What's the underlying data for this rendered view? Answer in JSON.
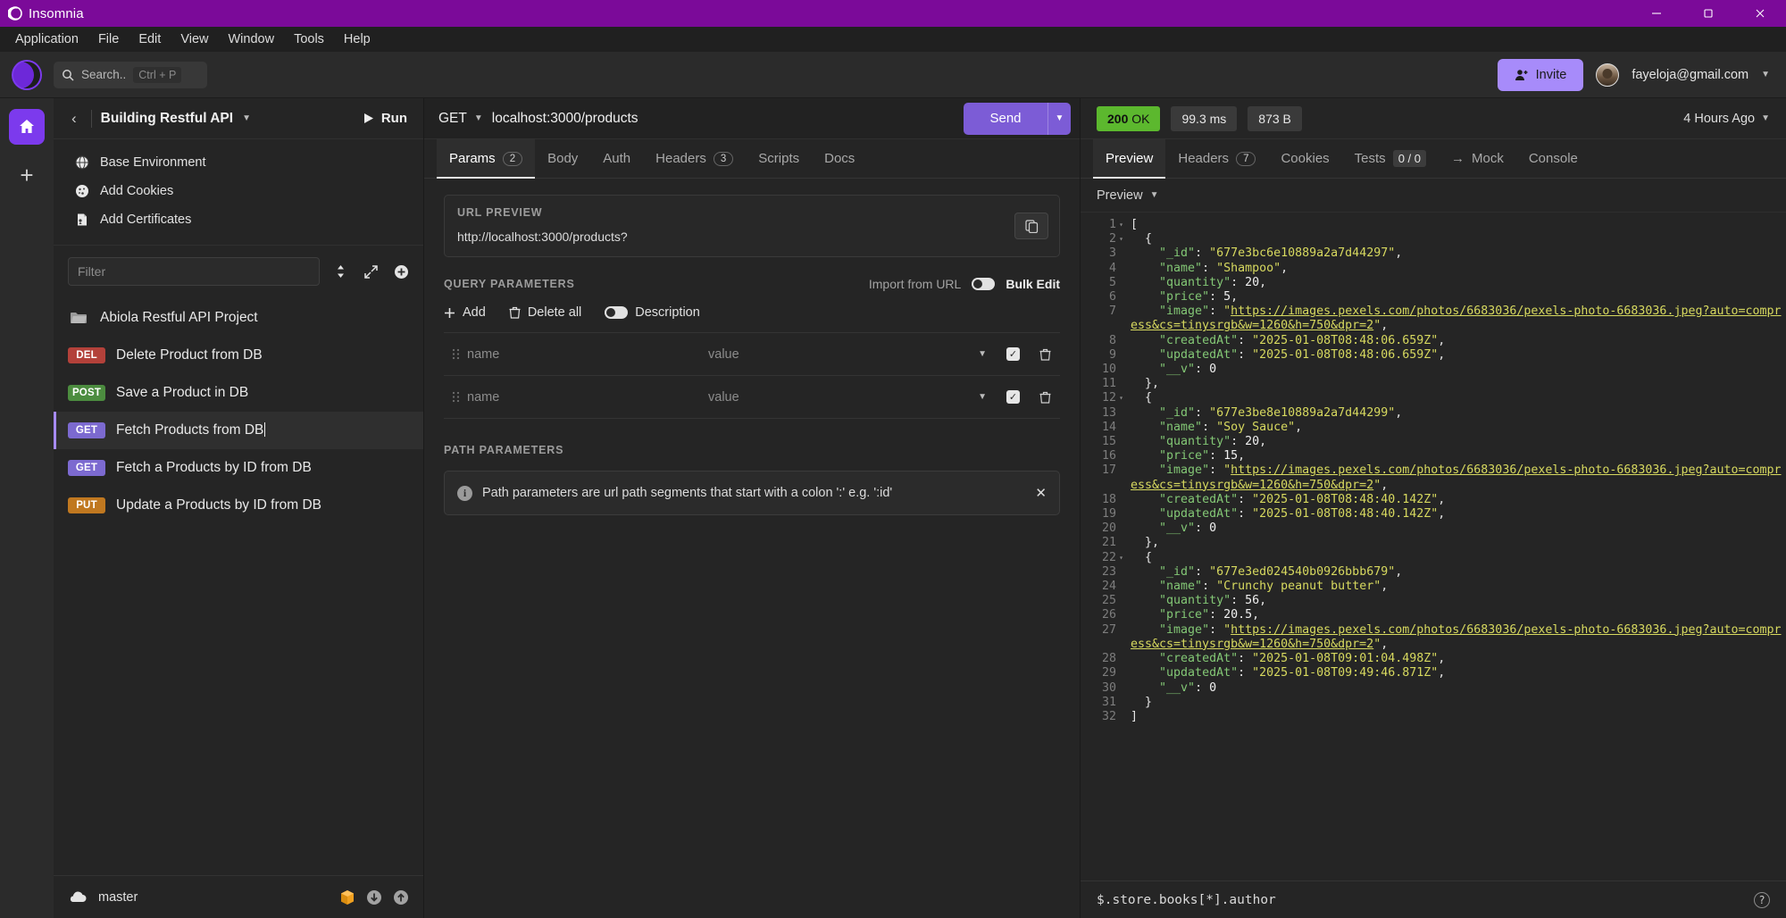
{
  "window": {
    "app_title": "Insomnia",
    "controls": {
      "minimize": "─",
      "maximize": "❐",
      "close": "✕"
    }
  },
  "menubar": {
    "items": [
      "Application",
      "File",
      "Edit",
      "View",
      "Window",
      "Tools",
      "Help"
    ]
  },
  "toolbar": {
    "search_placeholder": "Search..",
    "search_shortcut": "Ctrl + P",
    "invite_label": "Invite",
    "account_email": "fayeloja@gmail.com"
  },
  "sidebar": {
    "back_label": "‹",
    "workspace_title": "Building Restful API",
    "run_label": "Run",
    "env_items": [
      {
        "label": "Base Environment",
        "icon": "globe-icon"
      },
      {
        "label": "Add Cookies",
        "icon": "cookie-icon"
      },
      {
        "label": "Add Certificates",
        "icon": "certificate-icon"
      }
    ],
    "filter_placeholder": "Filter",
    "folder": {
      "label": "Abiola Restful API Project",
      "icon": "folder-icon"
    },
    "requests": [
      {
        "method": "DEL",
        "name": "Delete Product from DB",
        "active": false
      },
      {
        "method": "POST",
        "name": "Save a Product in DB",
        "active": false
      },
      {
        "method": "GET",
        "name": "Fetch Products from DB",
        "active": true
      },
      {
        "method": "GET",
        "name": "Fetch a Products by ID from DB",
        "active": false
      },
      {
        "method": "PUT",
        "name": "Update a Products by ID from DB",
        "active": false
      }
    ],
    "footer": {
      "branch": "master"
    }
  },
  "request": {
    "method": "GET",
    "url": "localhost:3000/products",
    "send_label": "Send",
    "tabs": [
      {
        "label": "Params",
        "badge": "2",
        "active": true
      },
      {
        "label": "Body",
        "badge": null,
        "active": false
      },
      {
        "label": "Auth",
        "badge": null,
        "active": false
      },
      {
        "label": "Headers",
        "badge": "3",
        "active": false
      },
      {
        "label": "Scripts",
        "badge": null,
        "active": false
      },
      {
        "label": "Docs",
        "badge": null,
        "active": false
      }
    ],
    "url_preview": {
      "label": "URL PREVIEW",
      "value": "http://localhost:3000/products?"
    },
    "query_parameters": {
      "label": "QUERY PARAMETERS",
      "import_label": "Import from URL",
      "bulk_edit_label": "Bulk Edit",
      "actions": {
        "add": "Add",
        "delete_all": "Delete all",
        "description": "Description"
      },
      "rows": [
        {
          "name_placeholder": "name",
          "value_placeholder": "value",
          "enabled": true
        },
        {
          "name_placeholder": "name",
          "value_placeholder": "value",
          "enabled": true
        }
      ]
    },
    "path_parameters": {
      "label": "PATH PARAMETERS",
      "note": "Path parameters are url path segments that start with a colon ':' e.g. ':id'"
    }
  },
  "response": {
    "status": {
      "code": "200",
      "text": "OK"
    },
    "time": "99.3 ms",
    "size": "873 B",
    "age": "4 Hours Ago",
    "tabs": [
      {
        "label": "Preview",
        "badge": null,
        "active": true
      },
      {
        "label": "Headers",
        "badge": "7",
        "active": false
      },
      {
        "label": "Cookies",
        "badge": null,
        "active": false
      },
      {
        "label": "Tests",
        "badge": "0 / 0",
        "active": false
      },
      {
        "label": "Mock",
        "badge": null,
        "active": false,
        "prefix": "→"
      },
      {
        "label": "Console",
        "badge": null,
        "active": false
      }
    ],
    "preview_mode": "Preview",
    "filter_value": "$.store.books[*].author",
    "body_lines": [
      {
        "num": "1",
        "fold": true,
        "html": "<span class='p'>[</span>"
      },
      {
        "num": "2",
        "fold": true,
        "html": "  <span class='p'>{</span>"
      },
      {
        "num": "3",
        "fold": false,
        "html": "    <span class='k'>\"_id\"</span><span class='p'>: </span><span class='s'>\"677e3bc6e10889a2a7d44297\"</span><span class='p'>,</span>"
      },
      {
        "num": "4",
        "fold": false,
        "html": "    <span class='k'>\"name\"</span><span class='p'>: </span><span class='s'>\"Shampoo\"</span><span class='p'>,</span>"
      },
      {
        "num": "5",
        "fold": false,
        "html": "    <span class='k'>\"quantity\"</span><span class='p'>: </span><span class='n'>20</span><span class='p'>,</span>"
      },
      {
        "num": "6",
        "fold": false,
        "html": "    <span class='k'>\"price\"</span><span class='p'>: </span><span class='n'>5</span><span class='p'>,</span>"
      },
      {
        "num": "7",
        "fold": false,
        "html": "    <span class='k'>\"image\"</span><span class='p'>: </span><span class='s'>\"</span><span class='lnk'>https://images.pexels.com/photos/6683036/pexels-photo-6683036.jpeg?auto=compress&amp;cs=tinysrgb&amp;w=1260&amp;h=750&amp;dpr=2</span><span class='s'>\"</span><span class='p'>,</span>"
      },
      {
        "num": "8",
        "fold": false,
        "html": "    <span class='k'>\"createdAt\"</span><span class='p'>: </span><span class='s'>\"2025-01-08T08:48:06.659Z\"</span><span class='p'>,</span>"
      },
      {
        "num": "9",
        "fold": false,
        "html": "    <span class='k'>\"updatedAt\"</span><span class='p'>: </span><span class='s'>\"2025-01-08T08:48:06.659Z\"</span><span class='p'>,</span>"
      },
      {
        "num": "10",
        "fold": false,
        "html": "    <span class='k'>\"__v\"</span><span class='p'>: </span><span class='n'>0</span>"
      },
      {
        "num": "11",
        "fold": false,
        "html": "  <span class='p'>},</span>"
      },
      {
        "num": "12",
        "fold": true,
        "html": "  <span class='p'>{</span>"
      },
      {
        "num": "13",
        "fold": false,
        "html": "    <span class='k'>\"_id\"</span><span class='p'>: </span><span class='s'>\"677e3be8e10889a2a7d44299\"</span><span class='p'>,</span>"
      },
      {
        "num": "14",
        "fold": false,
        "html": "    <span class='k'>\"name\"</span><span class='p'>: </span><span class='s'>\"Soy Sauce\"</span><span class='p'>,</span>"
      },
      {
        "num": "15",
        "fold": false,
        "html": "    <span class='k'>\"quantity\"</span><span class='p'>: </span><span class='n'>20</span><span class='p'>,</span>"
      },
      {
        "num": "16",
        "fold": false,
        "html": "    <span class='k'>\"price\"</span><span class='p'>: </span><span class='n'>15</span><span class='p'>,</span>"
      },
      {
        "num": "17",
        "fold": false,
        "html": "    <span class='k'>\"image\"</span><span class='p'>: </span><span class='s'>\"</span><span class='lnk'>https://images.pexels.com/photos/6683036/pexels-photo-6683036.jpeg?auto=compress&amp;cs=tinysrgb&amp;w=1260&amp;h=750&amp;dpr=2</span><span class='s'>\"</span><span class='p'>,</span>"
      },
      {
        "num": "18",
        "fold": false,
        "html": "    <span class='k'>\"createdAt\"</span><span class='p'>: </span><span class='s'>\"2025-01-08T08:48:40.142Z\"</span><span class='p'>,</span>"
      },
      {
        "num": "19",
        "fold": false,
        "html": "    <span class='k'>\"updatedAt\"</span><span class='p'>: </span><span class='s'>\"2025-01-08T08:48:40.142Z\"</span><span class='p'>,</span>"
      },
      {
        "num": "20",
        "fold": false,
        "html": "    <span class='k'>\"__v\"</span><span class='p'>: </span><span class='n'>0</span>"
      },
      {
        "num": "21",
        "fold": false,
        "html": "  <span class='p'>},</span>"
      },
      {
        "num": "22",
        "fold": true,
        "html": "  <span class='p'>{</span>"
      },
      {
        "num": "23",
        "fold": false,
        "html": "    <span class='k'>\"_id\"</span><span class='p'>: </span><span class='s'>\"677e3ed024540b0926bbb679\"</span><span class='p'>,</span>"
      },
      {
        "num": "24",
        "fold": false,
        "html": "    <span class='k'>\"name\"</span><span class='p'>: </span><span class='s'>\"Crunchy peanut butter\"</span><span class='p'>,</span>"
      },
      {
        "num": "25",
        "fold": false,
        "html": "    <span class='k'>\"quantity\"</span><span class='p'>: </span><span class='n'>56</span><span class='p'>,</span>"
      },
      {
        "num": "26",
        "fold": false,
        "html": "    <span class='k'>\"price\"</span><span class='p'>: </span><span class='n'>20.5</span><span class='p'>,</span>"
      },
      {
        "num": "27",
        "fold": false,
        "html": "    <span class='k'>\"image\"</span><span class='p'>: </span><span class='s'>\"</span><span class='lnk'>https://images.pexels.com/photos/6683036/pexels-photo-6683036.jpeg?auto=compress&amp;cs=tinysrgb&amp;w=1260&amp;h=750&amp;dpr=2</span><span class='s'>\"</span><span class='p'>,</span>"
      },
      {
        "num": "28",
        "fold": false,
        "html": "    <span class='k'>\"createdAt\"</span><span class='p'>: </span><span class='s'>\"2025-01-08T09:01:04.498Z\"</span><span class='p'>,</span>"
      },
      {
        "num": "29",
        "fold": false,
        "html": "    <span class='k'>\"updatedAt\"</span><span class='p'>: </span><span class='s'>\"2025-01-08T09:49:46.871Z\"</span><span class='p'>,</span>"
      },
      {
        "num": "30",
        "fold": false,
        "html": "    <span class='k'>\"__v\"</span><span class='p'>: </span><span class='n'>0</span>"
      },
      {
        "num": "31",
        "fold": false,
        "html": "  <span class='p'>}</span>"
      },
      {
        "num": "32",
        "fold": false,
        "html": "<span class='p'>]</span>"
      }
    ]
  },
  "colors": {
    "brand_purple": "#7b0a99",
    "accent_violet": "#7c3aed",
    "status_green": "#5cb82e",
    "method_get": "#7c6ad0",
    "method_post": "#4c8c3f",
    "method_del": "#b3413a",
    "method_put": "#c07820"
  }
}
